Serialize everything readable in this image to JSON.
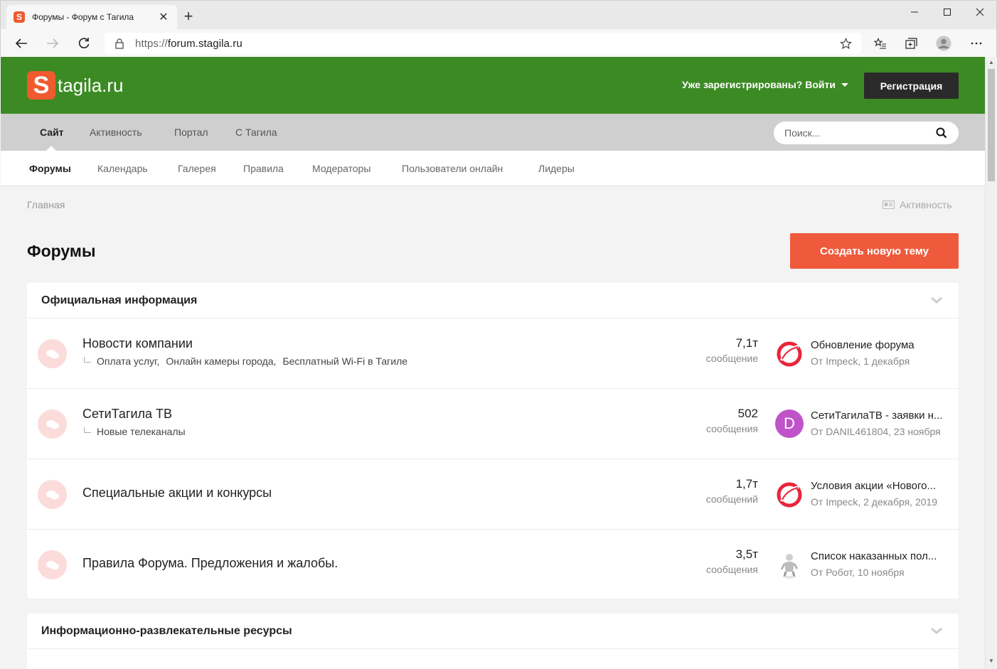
{
  "browser": {
    "tab_title": "Форумы - Форум с Тагила",
    "tab_favicon": "S",
    "url_protocol": "https://",
    "url_host": "forum.stagila.ru"
  },
  "site": {
    "logo_letter": "S",
    "logo_text": "tagila.ru",
    "signin_label": "Уже зарегистрированы? Войти",
    "register_label": "Регистрация",
    "colors": {
      "header_bg": "#3c8a24",
      "accent": "#ef5a3c",
      "nav_bg": "#cfcfcf"
    }
  },
  "mainnav": {
    "items": [
      "Сайт",
      "Активность",
      "Портал",
      "С Тагила"
    ],
    "active": "Сайт",
    "search_placeholder": "Поиск..."
  },
  "subnav": {
    "items": [
      "Форумы",
      "Календарь",
      "Галерея",
      "Правила",
      "Модераторы",
      "Пользователи онлайн",
      "Лидеры"
    ],
    "active": "Форумы"
  },
  "breadcrumb": "Главная",
  "activity_link": "Активность",
  "page_title": "Форумы",
  "new_topic_label": "Создать новую тему",
  "categories": [
    {
      "title": "Официальная информация",
      "forums": [
        {
          "name": "Новости компании",
          "subforums": [
            "Оплата услуг,",
            "Онлайн камеры города,",
            "Бесплатный Wi-Fi в Тагиле"
          ],
          "count": "7,1т",
          "count_label": "сообщение",
          "last_title": "Обновление форума",
          "last_meta": "От Impeck, 1 декабря",
          "avatar": "impeck-logo"
        },
        {
          "name": "СетиТагила ТВ",
          "subforums": [
            "Новые телеканалы"
          ],
          "count": "502",
          "count_label": "сообщения",
          "last_title": "СетиТагилаТВ - заявки н...",
          "last_meta": "От DANIL461804, 23 ноября",
          "avatar": "letter",
          "avatar_letter": "D"
        },
        {
          "name": "Специальные акции и конкурсы",
          "subforums": [],
          "count": "1,7т",
          "count_label": "сообщений",
          "last_title": "Условия акции «Нового...",
          "last_meta": "От Impeck, 2 декабря, 2019",
          "avatar": "impeck-logo"
        },
        {
          "name": "Правила Форума. Предложения и жалобы.",
          "subforums": [],
          "count": "3,5т",
          "count_label": "сообщения",
          "last_title": "Список наказанных пол...",
          "last_meta": "От Робот, 10 ноября",
          "avatar": "robot-figure"
        }
      ]
    },
    {
      "title": "Информационно-развлекательные ресурсы",
      "forums": []
    }
  ]
}
